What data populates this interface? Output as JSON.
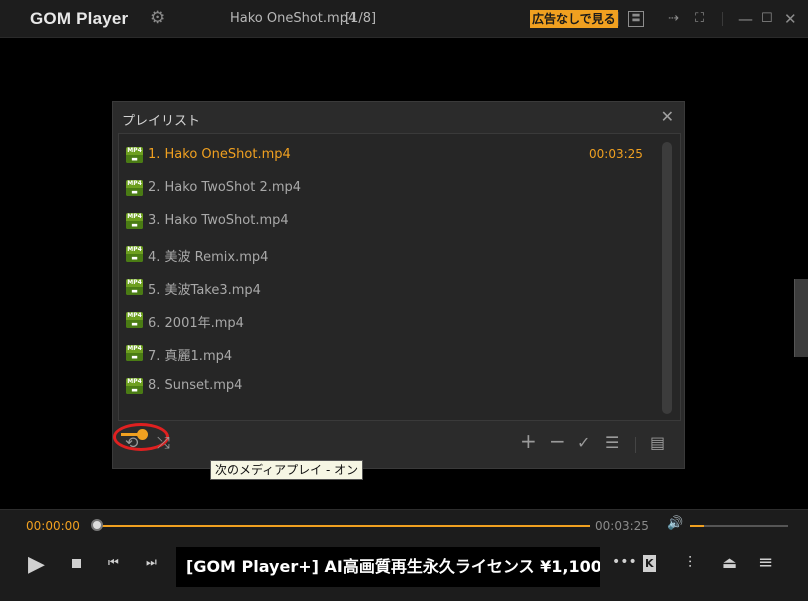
{
  "titlebar": {
    "logo": "GOM Player",
    "file_name": "Hako OneShot.mp4",
    "file_count": "[1/8]",
    "ad_free_label": "広告なしで見る",
    "settings_icon": "gear-icon"
  },
  "playlist": {
    "title": "プレイリスト",
    "items": [
      {
        "label": "1. Hako OneShot.mp4",
        "duration": "00:03:25",
        "active": true
      },
      {
        "label": "2. Hako TwoShot 2.mp4"
      },
      {
        "label": "3. Hako TwoShot.mp4"
      },
      {
        "label": "4. 美波 Remix.mp4"
      },
      {
        "label": "5. 美波Take3.mp4"
      },
      {
        "label": "6. 2001年.mp4"
      },
      {
        "label": "7. 真麗1.mp4"
      },
      {
        "label": "8. Sunset.mp4"
      }
    ],
    "file_icon_text": "MP4",
    "tooltip": "次のメディアプレイ - オン"
  },
  "controls": {
    "current_time": "00:00:00",
    "total_time": "00:03:25",
    "progress": 0.0,
    "volume": 0.14,
    "ad_banner": "[GOM Player+] AI高画質再生永久ライセンス ¥1,100",
    "kv_label": "K"
  },
  "colors": {
    "accent": "#f0a020",
    "highlight_ring": "#e02020"
  }
}
